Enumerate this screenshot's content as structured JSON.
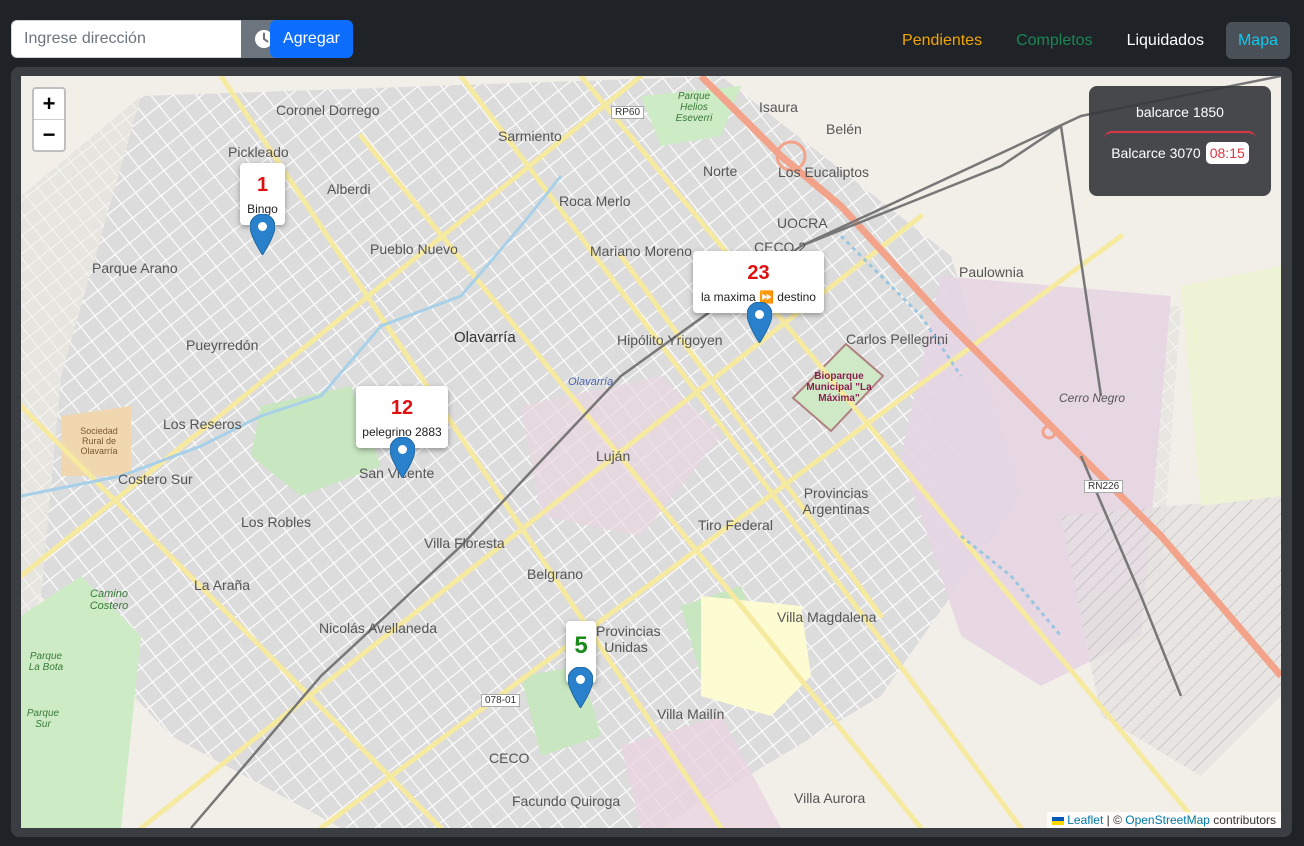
{
  "toolbar": {
    "address_placeholder": "Ingrese dirección",
    "add_label": "Agregar"
  },
  "nav": [
    {
      "label": "Pendientes",
      "color": "#f0a500"
    },
    {
      "label": "Completos",
      "color": "#198754"
    },
    {
      "label": "Liquidados",
      "color": "#ffffff"
    },
    {
      "label": "Mapa",
      "color": "#0dcaf0"
    }
  ],
  "route": {
    "from": "balcarce 1850",
    "to": "Balcarce 3070",
    "time": "08:15"
  },
  "markers": [
    {
      "number": "1",
      "label": "Bingo"
    },
    {
      "number": "23",
      "label": "la maxima ⏩ destino"
    },
    {
      "number": "12",
      "label": "pelegrino 2883"
    },
    {
      "number": "5",
      "label": ""
    }
  ],
  "map_labels": {
    "coronel_dorrego": "Coronel Dorrego",
    "sarmiento": "Sarmiento",
    "isaura": "Isaura",
    "belen": "Belén",
    "pickleado": "Pickleado",
    "alberdi": "Alberdi",
    "norte": "Norte",
    "los_eucaliptos": "Los Eucaliptos",
    "roca_merlo": "Roca Merlo",
    "uocra": "UOCRA",
    "pueblo_nuevo": "Pueblo Nuevo",
    "mariano_moreno": "Mariano Moreno",
    "ceco2": "CECO 2",
    "paulownia": "Paulownia",
    "parque_arano": "Parque Arano",
    "olavarria": "Olavarría",
    "hipolito_yrigoyen": "Hipólito Yrigoyen",
    "carlos_pellegrini": "Carlos Pellegrini",
    "pueyrredon": "Pueyrredón",
    "olavarria_station": "Olavarría",
    "bioparque": "Bioparque Municipal \"La Máxima\"",
    "cerro_negro": "Cerro Negro",
    "los_reseros": "Los Reseros",
    "sociedad_rural": "Sociedad Rural de Olavarría",
    "lujan": "Luján",
    "san_vicente": "San Vicente",
    "costero_sur": "Costero Sur",
    "provincias_argentinas": "Provincias Argentinas",
    "los_robles": "Los Robles",
    "tiro_federal": "Tiro Federal",
    "villa_floresta": "Villa Floresta",
    "belgrano": "Belgrano",
    "la_arana": "La Araña",
    "camino_costero": "Camino Costero",
    "villa_magdalena": "Villa Magdalena",
    "nicolas_avellaneda": "Nicolás Avellaneda",
    "provincias_unidas": "Provincias Unidas",
    "parque_la_bota": "Parque La Bota",
    "villa_mailin": "Villa Mailín",
    "parque_sur": "Parque Sur",
    "ceco": "CECO",
    "facundo_quiroga": "Facundo Quiroga",
    "villa_aurora": "Villa Aurora",
    "rp60": "RP60",
    "rn226": "RN226",
    "r07801": "078-01",
    "parque_helios": "Parque Helios Eseverri"
  },
  "attribution": {
    "leaflet": "Leaflet",
    "sep": " | © ",
    "osm": "OpenStreetMap",
    "contributors": " contributors"
  },
  "zoom": {
    "in": "+",
    "out": "−"
  }
}
